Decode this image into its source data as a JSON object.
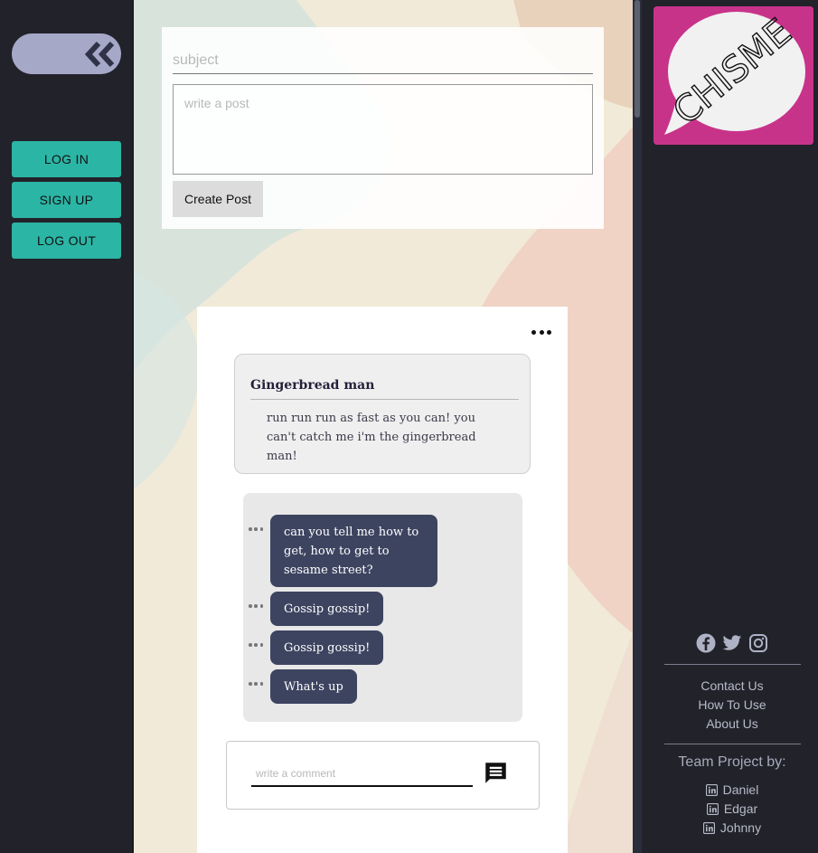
{
  "sidebar_left": {
    "collapse_icon": "double-chevron-left-icon",
    "buttons": [
      {
        "label": "LOG IN"
      },
      {
        "label": "SIGN UP"
      },
      {
        "label": "LOG OUT"
      }
    ]
  },
  "post_form": {
    "subject_placeholder": "subject",
    "body_placeholder": "write a post",
    "submit_label": "Create Post"
  },
  "post": {
    "menu_icon": "more-horizontal-icon",
    "title": "Gingerbread man",
    "body": "run run run as fast as you can! you can't catch me i'm the gingerbread man!",
    "comments": [
      {
        "text": "can you tell me how to get, how to get to sesame street?"
      },
      {
        "text": "Gossip gossip!"
      },
      {
        "text": "Gossip gossip!"
      },
      {
        "text": "What's up"
      }
    ],
    "comment_placeholder": "write a comment",
    "comment_send_icon": "message-icon"
  },
  "sidebar_right": {
    "logo_text": "CHISME",
    "social_icons": [
      "facebook-icon",
      "twitter-icon",
      "instagram-icon"
    ],
    "links": [
      "Contact Us",
      "How To Use",
      "About Us"
    ],
    "team_title": "Team Project by:",
    "team_members": [
      "Daniel",
      "Edgar",
      "Johnny"
    ]
  },
  "colors": {
    "sidebar_bg": "#22222a",
    "accent_teal": "#2bb5a5",
    "bubble": "#3d4460",
    "logo_pink": "#c8338a"
  }
}
